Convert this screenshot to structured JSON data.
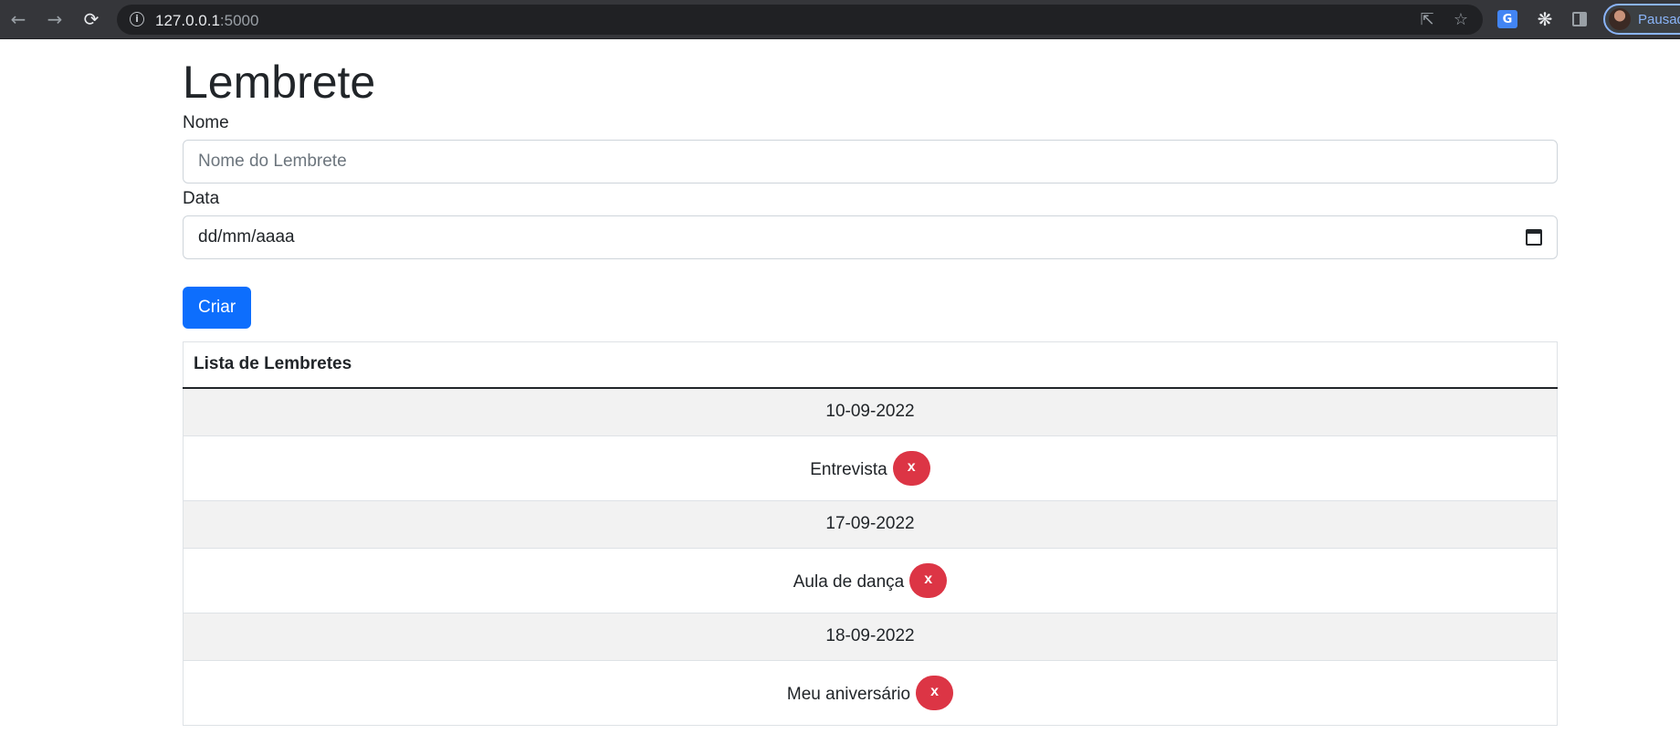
{
  "browser": {
    "url_host": "127.0.0.1",
    "url_port": ":5000",
    "profile_label": "Pausado"
  },
  "page": {
    "title": "Lembrete"
  },
  "form": {
    "name_label": "Nome",
    "name_placeholder": "Nome do Lembrete",
    "date_label": "Data",
    "date_value": "dd/mm/aaaa",
    "submit_label": "Criar"
  },
  "table": {
    "header": "Lista de Lembretes",
    "groups": [
      {
        "date": "10-09-2022",
        "items": [
          {
            "name": "Entrevista",
            "delete_label": "x"
          }
        ]
      },
      {
        "date": "17-09-2022",
        "items": [
          {
            "name": "Aula de dança",
            "delete_label": "x"
          }
        ]
      },
      {
        "date": "18-09-2022",
        "items": [
          {
            "name": "Meu aniversário",
            "delete_label": "x"
          }
        ]
      }
    ]
  },
  "colors": {
    "primary": "#0d6efd",
    "danger": "#dc3545",
    "date_row_bg": "#f2f2f2"
  },
  "icons": [
    "back-icon",
    "forward-icon",
    "reload-icon",
    "info-icon",
    "share-icon",
    "star-icon",
    "translate-icon",
    "extensions-icon",
    "side-panel-icon",
    "calendar-icon"
  ]
}
